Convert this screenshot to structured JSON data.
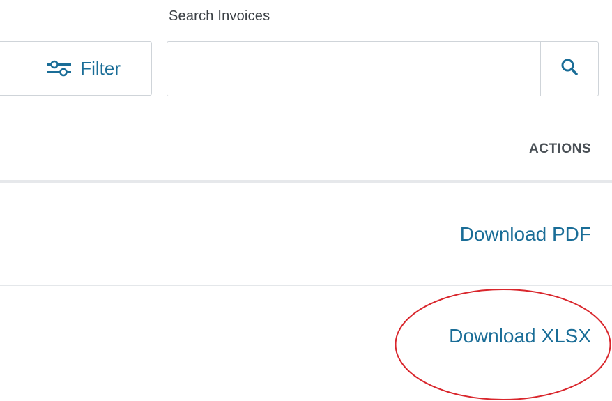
{
  "search": {
    "label": "Search Invoices",
    "placeholder": "",
    "value": "",
    "button_icon": "search-icon"
  },
  "toolbar": {
    "filter_label": "Filter",
    "filter_icon": "sliders-icon"
  },
  "table": {
    "columns": [
      {
        "label": "ACTIONS"
      }
    ],
    "rows": [
      {
        "action": "Download PDF"
      },
      {
        "action": "Download XLSX"
      }
    ]
  },
  "annotation": {
    "shape": "ellipse",
    "color": "#d9262c",
    "target": "Download XLSX"
  },
  "colors": {
    "link": "#1a6d97",
    "border": "#cfd4d9",
    "header_text": "#4a5056"
  }
}
